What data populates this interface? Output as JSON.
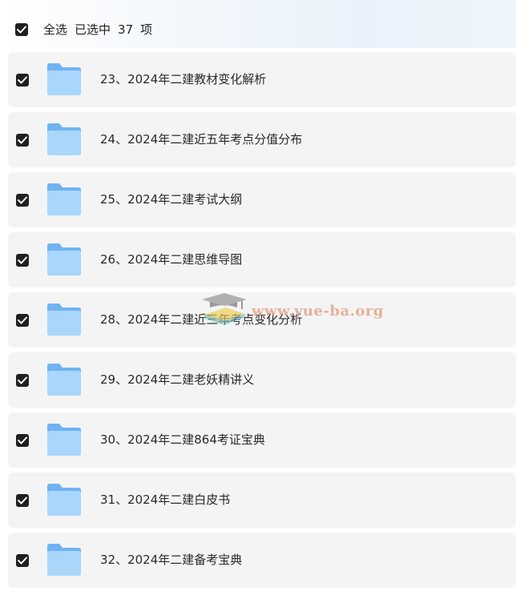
{
  "header": {
    "select_all_label": "全选",
    "selected_prefix": "已选中",
    "selected_count": "37",
    "selected_suffix": "项"
  },
  "items": [
    {
      "label": "23、2024年二建教材变化解析",
      "checked": true,
      "icon": "folder-icon"
    },
    {
      "label": "24、2024年二建近五年考点分值分布",
      "checked": true,
      "icon": "folder-icon"
    },
    {
      "label": "25、2024年二建考试大纲",
      "checked": true,
      "icon": "folder-icon"
    },
    {
      "label": "26、2024年二建思维导图",
      "checked": true,
      "icon": "folder-icon"
    },
    {
      "label": "28、2024年二建近三年考点变化分析",
      "checked": true,
      "icon": "folder-icon"
    },
    {
      "label": "29、2024年二建老妖精讲义",
      "checked": true,
      "icon": "folder-icon"
    },
    {
      "label": "30、2024年二建864考证宝典",
      "checked": true,
      "icon": "folder-icon"
    },
    {
      "label": "31、2024年二建白皮书",
      "checked": true,
      "icon": "folder-icon"
    },
    {
      "label": "32、2024年二建备考宝典",
      "checked": true,
      "icon": "folder-icon"
    }
  ],
  "watermark": {
    "text": "www.yue-ba.org",
    "icon": "graduation-cap-icon"
  },
  "colors": {
    "checkbox": "#1f1f1f",
    "row_background": "#f4f4f5",
    "folder_back": "#6fb3f2",
    "folder_front": "#a9d6fb",
    "watermark_text": "#e6a58a"
  }
}
